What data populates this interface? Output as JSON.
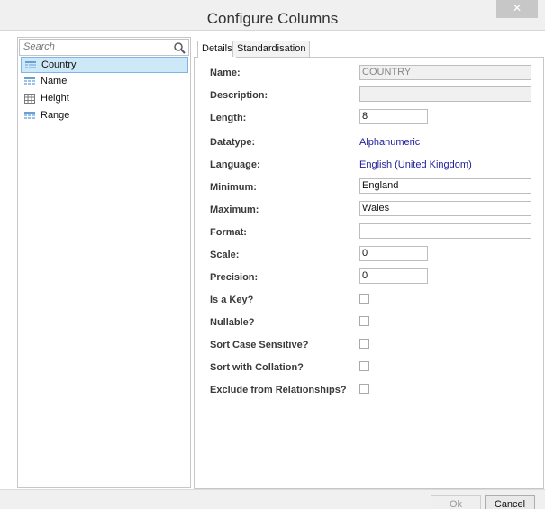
{
  "window": {
    "title": "Configure Columns",
    "close_glyph": "✕"
  },
  "search": {
    "placeholder": "Search"
  },
  "columns": [
    {
      "label": "Country",
      "icon": "text-column-icon",
      "selected": true
    },
    {
      "label": "Name",
      "icon": "text-column-icon",
      "selected": false
    },
    {
      "label": "Height",
      "icon": "numeric-column-icon",
      "selected": false
    },
    {
      "label": "Range",
      "icon": "text-column-icon",
      "selected": false
    }
  ],
  "tabs": [
    {
      "label": "Details",
      "active": true
    },
    {
      "label": "Standardisation",
      "active": false
    }
  ],
  "details": {
    "name": {
      "label": "Name:",
      "value": "COUNTRY"
    },
    "description": {
      "label": "Description:",
      "value": ""
    },
    "length": {
      "label": "Length:",
      "value": "8"
    },
    "datatype": {
      "label": "Datatype:",
      "value": "Alphanumeric"
    },
    "language": {
      "label": "Language:",
      "value": "English (United Kingdom)"
    },
    "minimum": {
      "label": "Minimum:",
      "value": "England"
    },
    "maximum": {
      "label": "Maximum:",
      "value": "Wales"
    },
    "format": {
      "label": "Format:",
      "value": ""
    },
    "scale": {
      "label": "Scale:",
      "value": "0"
    },
    "precision": {
      "label": "Precision:",
      "value": "0"
    },
    "is_key": {
      "label": "Is a Key?",
      "checked": false
    },
    "nullable": {
      "label": "Nullable?",
      "checked": false
    },
    "sort_case_sensitive": {
      "label": "Sort Case Sensitive?",
      "checked": false
    },
    "sort_with_collation": {
      "label": "Sort with Collation?",
      "checked": false
    },
    "exclude_from_relationships": {
      "label": "Exclude from Relationships?",
      "checked": false
    }
  },
  "buttons": {
    "ok": {
      "label": "Ok",
      "enabled": false
    },
    "cancel": {
      "label": "Cancel",
      "enabled": true
    }
  },
  "colors": {
    "selection_bg": "#cde8f7",
    "selection_border": "#7eb4ea",
    "link_text": "#1f1f99",
    "column_icon": "#6a9fd4"
  }
}
